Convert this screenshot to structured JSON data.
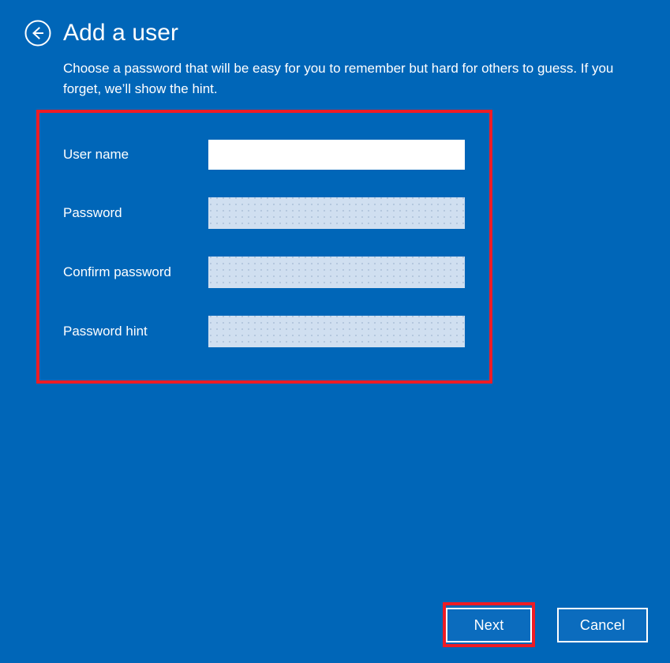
{
  "window": {
    "background_color": "#0066b8",
    "accent_color": "#0b6cbe",
    "highlight_color": "#ee1c25"
  },
  "header": {
    "back_button_icon": "back-arrow-circle-icon",
    "title": "Add a user",
    "subtitle": "Choose a password that will be easy for you to remember but hard for others to guess. If you forget, we’ll show the hint."
  },
  "form": {
    "fields": [
      {
        "id": "user-name",
        "label": "User name",
        "value": "",
        "placeholder": "",
        "state": "active",
        "focused": true
      },
      {
        "id": "password",
        "label": "Password",
        "value": "",
        "placeholder": "",
        "state": "inactive",
        "focused": false
      },
      {
        "id": "confirm-password",
        "label": "Confirm password",
        "value": "",
        "placeholder": "",
        "state": "inactive",
        "focused": false
      },
      {
        "id": "password-hint",
        "label": "Password hint",
        "value": "",
        "placeholder": "",
        "state": "inactive",
        "focused": false
      }
    ]
  },
  "footer": {
    "next_label": "Next",
    "cancel_label": "Cancel"
  }
}
